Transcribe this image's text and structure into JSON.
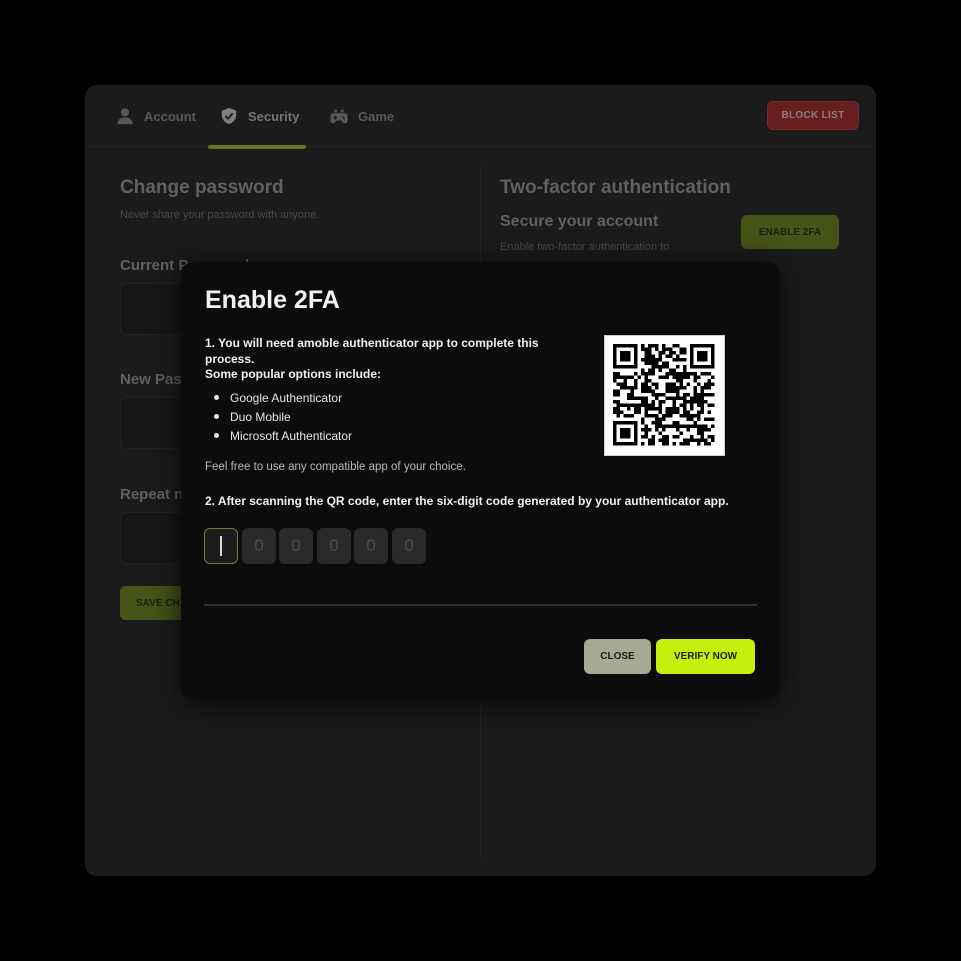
{
  "tabs": [
    {
      "label": "Account",
      "icon": "user-icon"
    },
    {
      "label": "Security",
      "icon": "shield-check-icon"
    },
    {
      "label": "Game",
      "icon": "gamepad-icon"
    }
  ],
  "active_tab": "Security",
  "block_list_label": "BLOCK LIST",
  "change_password": {
    "title": "Change password",
    "subtitle": "Never share your password with anyone.",
    "current_label": "Current Password",
    "new_label": "New Password",
    "repeat_label": "Repeat new password",
    "save_label": "SAVE CHANGES"
  },
  "two_factor": {
    "title": "Two-factor authentication",
    "secure_title": "Secure your account",
    "secure_desc": "Enable two-factor authentication to",
    "enable_label": "ENABLE 2FA"
  },
  "modal": {
    "title": "Enable 2FA",
    "step1_line1": "1. You will need amoble authenticator app to complete this process.",
    "step1_line2": "Some popular options include:",
    "apps": [
      "Google Authenticator",
      "Duo Mobile",
      "Microsoft Authenticator"
    ],
    "feel_free": "Feel free to use any compatible app of your choice.",
    "step2": "2. After scanning the QR code, enter the six-digit code generated by your authenticator app.",
    "code_placeholders": [
      "",
      "0",
      "0",
      "0",
      "0",
      "0"
    ],
    "close_label": "CLOSE",
    "verify_label": "VERIFY NOW"
  },
  "colors": {
    "accent": "#c6ef0e",
    "accent_dim": "#6b8414",
    "danger": "#a42222",
    "panel": "#1b1b1b",
    "modal": "#0c0c0c"
  }
}
